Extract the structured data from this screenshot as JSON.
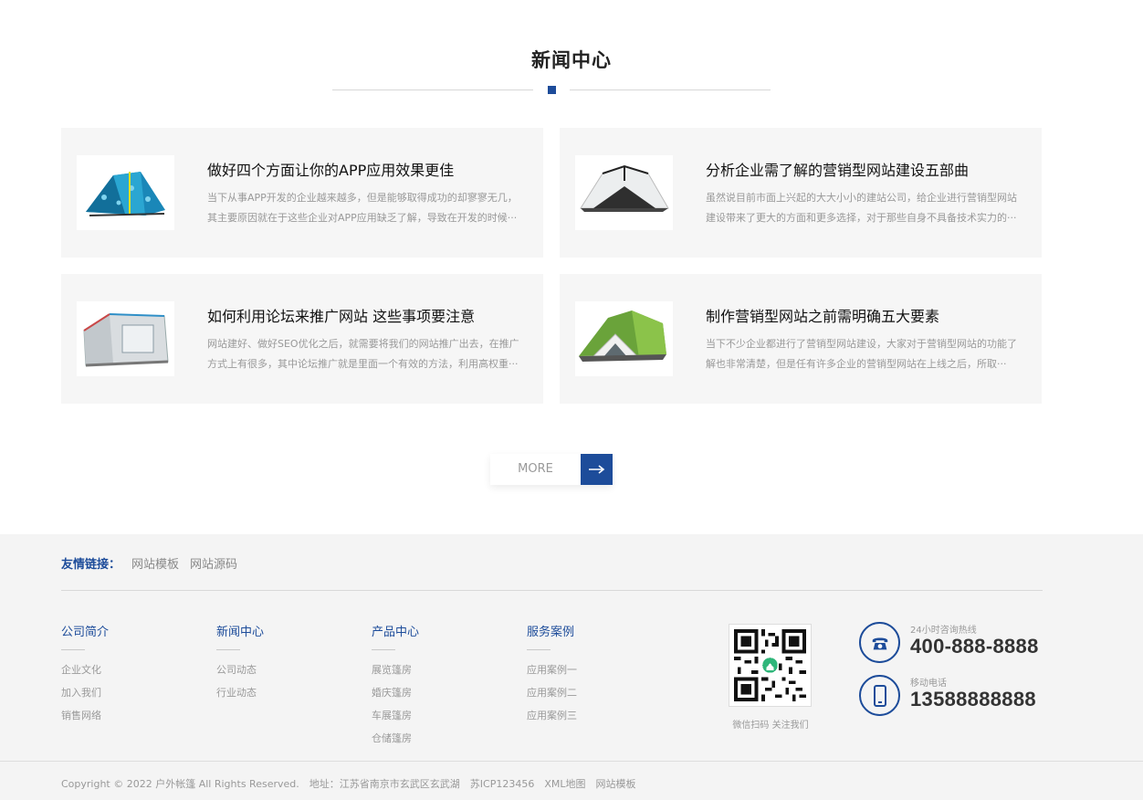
{
  "news": {
    "title": "新闻中心",
    "more_label": "MORE",
    "articles": [
      {
        "title": "做好四个方面让你的APP应用效果更佳",
        "desc": "当下从事APP开发的企业越来越多，但是能够取得成功的却寥寥无几，其主要原因就在于这些企业对APP应用缺乏了解，导致在开发的时候···",
        "image": "blue-patterned-tent"
      },
      {
        "title": "分析企业需了解的营销型网站建设五部曲",
        "desc": "虽然说目前市面上兴起的大大小小的建站公司，给企业进行营销型网站建设带来了更大的方面和更多选择，对于那些自身不具备技术实力的···",
        "image": "white-dome-tent"
      },
      {
        "title": "如何利用论坛来推广网站 这些事项要注意",
        "desc": "网站建好、做好SEO优化之后，就需要将我们的网站推广出去，在推广方式上有很多，其中论坛推广就是里面一个有效的方法，利用高权重···",
        "image": "grey-cabin-tent"
      },
      {
        "title": "制作营销型网站之前需明确五大要素",
        "desc": "当下不少企业都进行了营销型网站建设，大家对于营销型网站的功能了解也非常清楚，但是任有许多企业的营销型网站在上线之后，所取···",
        "image": "green-dome-tent"
      }
    ]
  },
  "footer": {
    "links_label": "友情链接：",
    "links": [
      "网站模板",
      "网站源码"
    ],
    "columns": [
      {
        "title": "公司简介",
        "items": [
          "企业文化",
          "加入我们",
          "销售网络"
        ]
      },
      {
        "title": "新闻中心",
        "items": [
          "公司动态",
          "行业动态"
        ]
      },
      {
        "title": "产品中心",
        "items": [
          "展览篷房",
          "婚庆篷房",
          "车展篷房",
          "仓储篷房"
        ]
      },
      {
        "title": "服务案例",
        "items": [
          "应用案例一",
          "应用案例二",
          "应用案例三"
        ]
      }
    ],
    "qr_caption": "微信扫码 关注我们",
    "hotline": {
      "label": "24小时咨询热线",
      "number": "400-888-8888",
      "icon": "phone-icon"
    },
    "mobile": {
      "label": "移动电话",
      "number": "13588888888",
      "icon": "mobile-icon"
    },
    "copyright": "Copyright © 2022 户外帐篷 All Rights Reserved.",
    "address": "地址：江苏省南京市玄武区玄武湖",
    "icp": "苏ICP123456",
    "bottom_links": [
      "XML地图",
      "网站模板"
    ]
  },
  "colors": {
    "accent": "#1d4c9a",
    "footer_bg": "#f4f4f4",
    "card_bg": "#f6f6f6"
  }
}
